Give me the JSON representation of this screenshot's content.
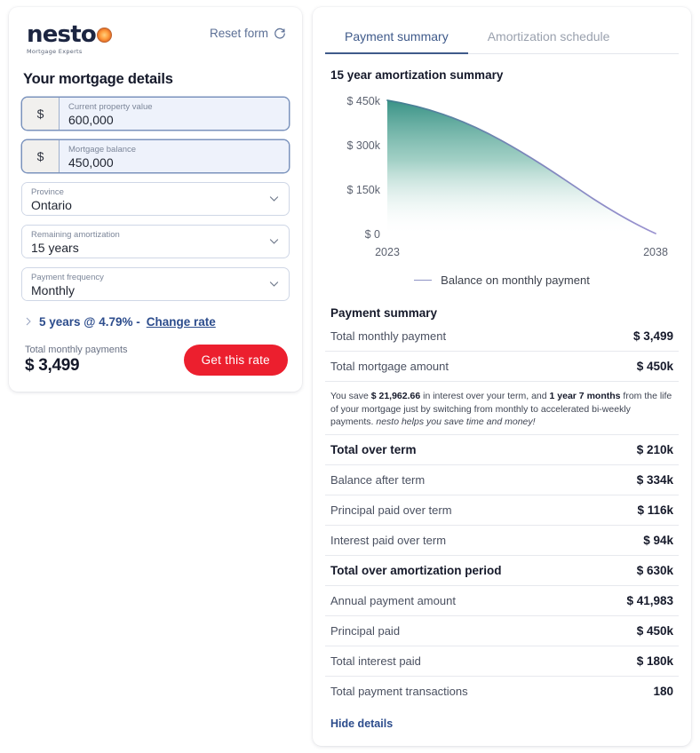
{
  "brand": {
    "name": "nesto",
    "tagline": "Mortgage Experts",
    "accent_red": "#ec1f2e",
    "accent_blue": "#2c4c8c"
  },
  "left_panel": {
    "reset_label": "Reset form",
    "title": "Your mortgage details",
    "fields": [
      {
        "prefix": "$",
        "label": "Current property value",
        "value": "600,000",
        "type": "money"
      },
      {
        "prefix": "$",
        "label": "Mortgage balance",
        "value": "450,000",
        "type": "money"
      },
      {
        "label": "Province",
        "value": "Ontario",
        "type": "select"
      },
      {
        "label": "Remaining amortization",
        "value": "15 years",
        "type": "select"
      },
      {
        "label": "Payment frequency",
        "value": "Monthly",
        "type": "select"
      }
    ],
    "rate_text": "5 years @ 4.79% -",
    "change_rate_label": "Change rate",
    "totals_label": "Total monthly payments",
    "totals_value": "$ 3,499",
    "cta_label": "Get this rate"
  },
  "right_panel": {
    "tabs": [
      {
        "label": "Payment summary",
        "active": true
      },
      {
        "label": "Amortization schedule",
        "active": false
      }
    ],
    "chart_title": "15 year amortization summary",
    "summary_heading": "Payment summary",
    "top_rows": [
      {
        "label": "Total monthly payment",
        "value": "$ 3,499"
      },
      {
        "label": "Total mortgage amount",
        "value": "$ 450k"
      }
    ],
    "note": {
      "p1": "You save ",
      "b1": "$ 21,962.66",
      "p2": " in interest over your term, and ",
      "b2": "1 year 7 months",
      "p3": " from the life of your mortgage just by switching from monthly to accelerated bi-weekly payments. ",
      "i1": "nesto helps you save time and money!"
    },
    "rows": [
      {
        "label": "Total over term",
        "value": "$ 210k",
        "strong": true
      },
      {
        "label": "Balance after term",
        "value": "$ 334k",
        "strong": false
      },
      {
        "label": "Principal paid over term",
        "value": "$ 116k",
        "strong": false
      },
      {
        "label": "Interest paid over term",
        "value": "$ 94k",
        "strong": false
      },
      {
        "label": "Total over amortization period",
        "value": "$ 630k",
        "strong": true
      },
      {
        "label": "Annual payment amount",
        "value": "$ 41,983",
        "strong": false
      },
      {
        "label": "Principal paid",
        "value": "$ 450k",
        "strong": false
      },
      {
        "label": "Total interest paid",
        "value": "$ 180k",
        "strong": false
      },
      {
        "label": "Total payment transactions",
        "value": "180",
        "strong": false
      }
    ],
    "hide_details_label": "Hide details"
  },
  "chart_data": {
    "type": "area",
    "title": "15 year amortization summary",
    "xlabel": "",
    "ylabel": "",
    "legend": [
      "Balance on monthly payment"
    ],
    "legend_position": "bottom",
    "grid": false,
    "x_ticks": [
      "2023",
      "2038"
    ],
    "y_ticks": [
      "$ 0",
      "$ 150k",
      "$ 300k",
      "$ 450k"
    ],
    "xlim": [
      2023,
      2038
    ],
    "ylim": [
      0,
      450000
    ],
    "line_color": "#8e93c6",
    "fill_gradient": [
      "#3f9e8e",
      "#ffffff"
    ],
    "x": [
      2023,
      2024,
      2025,
      2026,
      2027,
      2028,
      2029,
      2030,
      2031,
      2032,
      2033,
      2034,
      2035,
      2036,
      2037,
      2038
    ],
    "series": [
      {
        "name": "Balance on monthly payment",
        "values": [
          450000,
          430000,
          409000,
          387000,
          364000,
          334000,
          314000,
          287000,
          259000,
          229000,
          198000,
          165000,
          131000,
          95000,
          49000,
          0
        ]
      }
    ]
  }
}
